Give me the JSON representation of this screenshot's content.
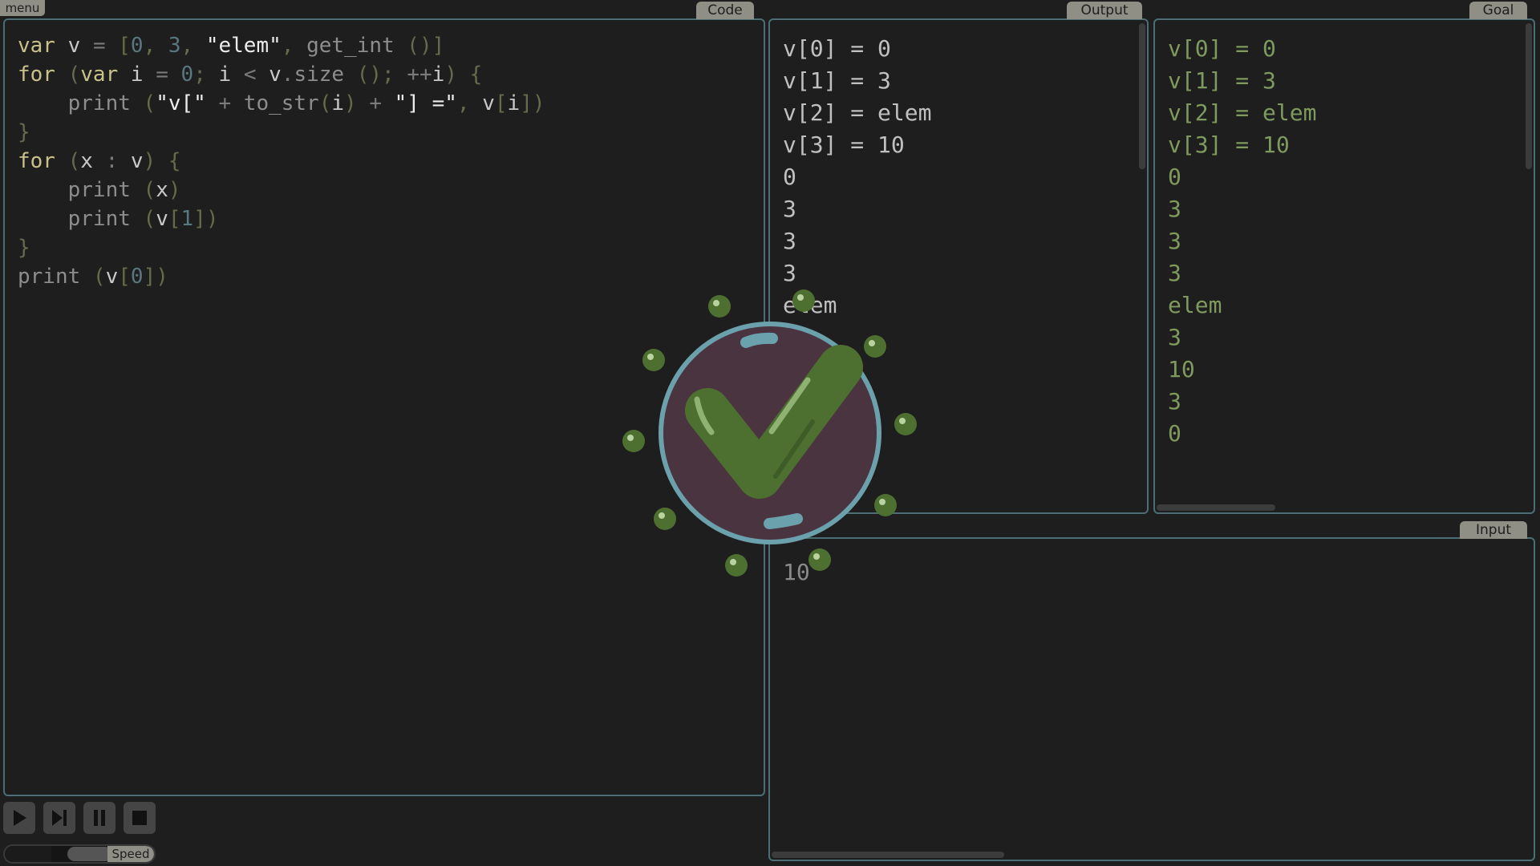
{
  "menu": {
    "label": "menu"
  },
  "code": {
    "title": "Code",
    "lines": [
      [
        {
          "t": "var",
          "c": "k"
        },
        {
          "t": " v ",
          "c": "v"
        },
        {
          "t": "=",
          "c": "d"
        },
        {
          "t": " [",
          "c": "dk"
        },
        {
          "t": "0",
          "c": "n"
        },
        {
          "t": ",",
          "c": "dk"
        },
        {
          "t": " 3",
          "c": "n"
        },
        {
          "t": ",",
          "c": "dk"
        },
        {
          "t": " \"elem\"",
          "c": "s"
        },
        {
          "t": ",",
          "c": "dk"
        },
        {
          "t": " get_int",
          "c": "f"
        },
        {
          "t": " ()]",
          "c": "dk"
        }
      ],
      [
        {
          "t": "for",
          "c": "k"
        },
        {
          "t": " (",
          "c": "dk"
        },
        {
          "t": "var",
          "c": "k"
        },
        {
          "t": " i ",
          "c": "v"
        },
        {
          "t": "=",
          "c": "d"
        },
        {
          "t": " 0",
          "c": "n"
        },
        {
          "t": ";",
          "c": "dk"
        },
        {
          "t": " i ",
          "c": "v"
        },
        {
          "t": "<",
          "c": "d"
        },
        {
          "t": " v",
          "c": "v"
        },
        {
          "t": ".",
          "c": "d"
        },
        {
          "t": "size",
          "c": "f"
        },
        {
          "t": " ()",
          "c": "dk"
        },
        {
          "t": ";",
          "c": "dk"
        },
        {
          "t": " ++",
          "c": "d"
        },
        {
          "t": "i",
          "c": "v"
        },
        {
          "t": ") {",
          "c": "dk"
        }
      ],
      [
        {
          "t": "    print",
          "c": "f"
        },
        {
          "t": " (",
          "c": "dk"
        },
        {
          "t": "\"v[\"",
          "c": "s"
        },
        {
          "t": " +",
          "c": "d"
        },
        {
          "t": " to_str",
          "c": "f"
        },
        {
          "t": "(",
          "c": "dk"
        },
        {
          "t": "i",
          "c": "v"
        },
        {
          "t": ")",
          "c": "dk"
        },
        {
          "t": " +",
          "c": "d"
        },
        {
          "t": " \"] =\"",
          "c": "s"
        },
        {
          "t": ",",
          "c": "dk"
        },
        {
          "t": " v",
          "c": "v"
        },
        {
          "t": "[",
          "c": "dk"
        },
        {
          "t": "i",
          "c": "v"
        },
        {
          "t": "])",
          "c": "dk"
        }
      ],
      [
        {
          "t": "}",
          "c": "dk"
        }
      ],
      [
        {
          "t": "for",
          "c": "k"
        },
        {
          "t": " (",
          "c": "dk"
        },
        {
          "t": "x",
          "c": "v"
        },
        {
          "t": " :",
          "c": "d"
        },
        {
          "t": " v",
          "c": "v"
        },
        {
          "t": ") {",
          "c": "dk"
        }
      ],
      [
        {
          "t": "    print",
          "c": "f"
        },
        {
          "t": " (",
          "c": "dk"
        },
        {
          "t": "x",
          "c": "v"
        },
        {
          "t": ")",
          "c": "dk"
        }
      ],
      [
        {
          "t": "    print",
          "c": "f"
        },
        {
          "t": " (",
          "c": "dk"
        },
        {
          "t": "v",
          "c": "v"
        },
        {
          "t": "[",
          "c": "dk"
        },
        {
          "t": "1",
          "c": "n"
        },
        {
          "t": "])",
          "c": "dk"
        }
      ],
      [
        {
          "t": "}",
          "c": "dk"
        }
      ],
      [
        {
          "t": "print",
          "c": "f"
        },
        {
          "t": " (",
          "c": "dk"
        },
        {
          "t": "v",
          "c": "v"
        },
        {
          "t": "[",
          "c": "dk"
        },
        {
          "t": "0",
          "c": "n"
        },
        {
          "t": "])",
          "c": "dk"
        }
      ]
    ]
  },
  "output": {
    "title": "Output",
    "lines": [
      "v[0] = 0",
      "v[1] = 3",
      "v[2] = elem",
      "v[3] = 10",
      "0",
      "3",
      "3",
      "3",
      "elem"
    ]
  },
  "goal": {
    "title": "Goal",
    "lines": [
      "v[0] = 0",
      "v[1] = 3",
      "v[2] = elem",
      "v[3] = 10",
      "0",
      "3",
      "3",
      "3",
      "elem",
      "3",
      "10",
      "3",
      "0"
    ]
  },
  "input": {
    "title": "Input",
    "lines": [
      "10"
    ]
  },
  "controls": {
    "buttons": [
      "play-icon",
      "step-icon",
      "pause-icon",
      "stop-icon"
    ],
    "speed_label": "Speed",
    "speed_level": 0.31
  },
  "overlay": {
    "icon": "checkmark-success-icon"
  },
  "colors": {
    "panel_border": "#4a6e73",
    "tab_bg": "#8f8f86",
    "background": "#1e1e1e",
    "check_green": "#4d7030",
    "circle_fill": "#4a3440",
    "circle_ring": "#6aa1ad"
  }
}
